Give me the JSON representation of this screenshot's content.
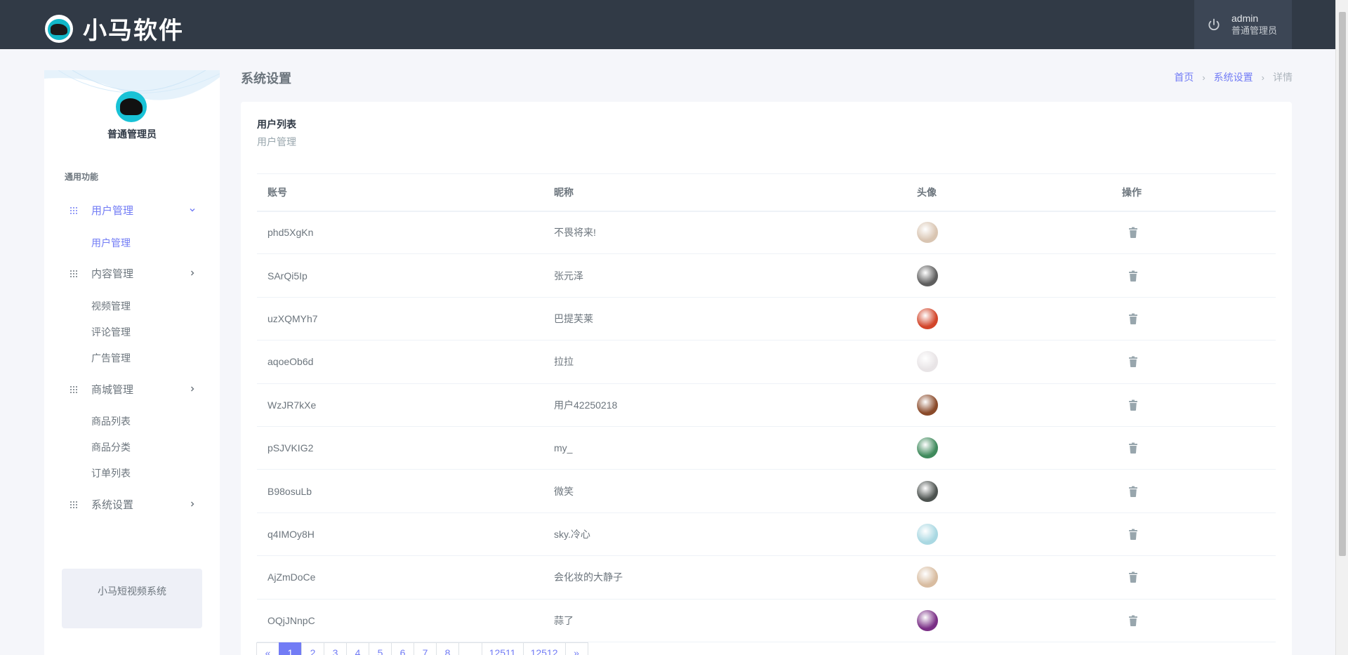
{
  "app": {
    "brand_name": "小马软件"
  },
  "header": {
    "username": "admin",
    "role": "普通管理员"
  },
  "sidebar": {
    "role": "普通管理员",
    "section_title": "通用功能",
    "menus": [
      {
        "label": "用户管理",
        "expanded": true,
        "active": true,
        "sub": [
          {
            "label": "用户管理",
            "active": true
          }
        ]
      },
      {
        "label": "内容管理",
        "expanded": false,
        "active": false,
        "sub": [
          {
            "label": "视频管理"
          },
          {
            "label": "评论管理"
          },
          {
            "label": "广告管理"
          }
        ]
      },
      {
        "label": "商城管理",
        "expanded": false,
        "active": false,
        "sub": [
          {
            "label": "商品列表"
          },
          {
            "label": "商品分类"
          },
          {
            "label": "订单列表"
          }
        ]
      },
      {
        "label": "系统设置",
        "expanded": false,
        "active": false,
        "sub": []
      }
    ],
    "footer_text": "小马短视频系统"
  },
  "page": {
    "title": "系统设置",
    "breadcrumb": [
      "首页",
      "系统设置",
      "详情"
    ],
    "card_title": "用户列表",
    "card_subtitle": "用户管理"
  },
  "table": {
    "headers": [
      "账号",
      "昵称",
      "头像",
      "操作"
    ],
    "rows": [
      {
        "account": "phd5XgKn",
        "nickname": "不畏将来!",
        "avatar_color": "#d9c5b2"
      },
      {
        "account": "SArQi5Ip",
        "nickname": "张元泽",
        "avatar_color": "#5e5e5e"
      },
      {
        "account": "uzXQMYh7",
        "nickname": "巴提芙莱",
        "avatar_color": "#d2452a"
      },
      {
        "account": "aqoeOb6d",
        "nickname": "拉拉",
        "avatar_color": "#e8e4e6"
      },
      {
        "account": "WzJR7kXe",
        "nickname": "用户42250218",
        "avatar_color": "#8a4a2a"
      },
      {
        "account": "pSJVKIG2",
        "nickname": "my_",
        "avatar_color": "#3f8a5c"
      },
      {
        "account": "B98osuLb",
        "nickname": "微笑",
        "avatar_color": "#4d5350"
      },
      {
        "account": "q4IMOy8H",
        "nickname": "sky.冷心",
        "avatar_color": "#a9d8e2"
      },
      {
        "account": "AjZmDoCe",
        "nickname": "会化妆的大静子",
        "avatar_color": "#d8bca0"
      },
      {
        "account": "OQjJNnpC",
        "nickname": "蒜了",
        "avatar_color": "#7a2f86"
      }
    ]
  },
  "pagination": {
    "items": [
      "«",
      "1",
      "2",
      "3",
      "4",
      "5",
      "6",
      "7",
      "8",
      "...",
      "12511",
      "12512",
      "»"
    ],
    "active": "1"
  },
  "colors": {
    "accent": "#727cf5",
    "header_bg": "#313a46",
    "page_bg": "#f5f6fa"
  }
}
